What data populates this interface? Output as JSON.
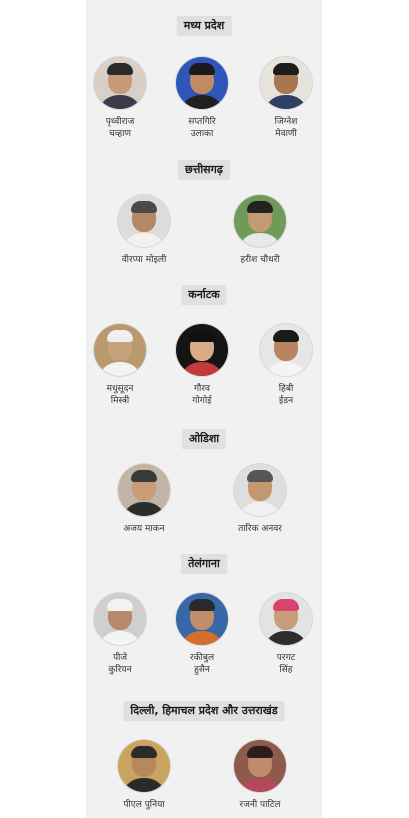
{
  "sections": [
    {
      "heading": "मध्य प्रदेश",
      "people": [
        {
          "line1": "पृथ्वीराज",
          "line2": "चव्हाण",
          "bg": "#d9cfc4",
          "skin": "#c59a78",
          "hair": "#2a2a2a",
          "cloth": "#3b3b4a"
        },
        {
          "line1": "सप्तगिरि",
          "line2": "उलाका",
          "bg": "#2f55b8",
          "skin": "#c08a63",
          "hair": "#1a1a1a",
          "cloth": "#202020"
        },
        {
          "line1": "जिग्नेश",
          "line2": "मेवाणी",
          "bg": "#e6e2dc",
          "skin": "#a97552",
          "hair": "#1d1d1d",
          "cloth": "#2d3f63"
        }
      ]
    },
    {
      "heading": "छत्तीसगढ़",
      "people": [
        {
          "line1": "वीरप्पा मोइली",
          "line2": "",
          "bg": "#dcdcdc",
          "skin": "#b58763",
          "hair": "#4a4a4a",
          "cloth": "#f1f1f1"
        },
        {
          "line1": "हरीश चौधरी",
          "line2": "",
          "bg": "#6f9a57",
          "skin": "#c39a72",
          "hair": "#222222",
          "cloth": "#e8e8e8"
        }
      ]
    },
    {
      "heading": "कर्नाटक",
      "people": [
        {
          "line1": "मधुसूदन",
          "line2": "मिस्त्री",
          "bg": "#b89a6e",
          "skin": "#c7a17c",
          "hair": "#efefef",
          "cloth": "#f3f3f3"
        },
        {
          "line1": "गौरव",
          "line2": "गोगोई",
          "bg": "#151515",
          "skin": "#d8ab85",
          "hair": "#111111",
          "cloth": "#c23a3a"
        },
        {
          "line1": "हिबी",
          "line2": "ईडन",
          "bg": "#e6e6e6",
          "skin": "#b98460",
          "hair": "#1a1a1a",
          "cloth": "#f4f4f4"
        }
      ]
    },
    {
      "heading": "ओडिशा",
      "people": [
        {
          "line1": "अजय माकन",
          "line2": "",
          "bg": "#c2b5a7",
          "skin": "#c79c78",
          "hair": "#3a3a3a",
          "cloth": "#2c2c2c"
        },
        {
          "line1": "तारिक अनवर",
          "line2": "",
          "bg": "#dedede",
          "skin": "#c4976f",
          "hair": "#555555",
          "cloth": "#f0f0f0"
        }
      ]
    },
    {
      "heading": "तेलंगाना",
      "people": [
        {
          "line1": "पीजे",
          "line2": "कुरियन",
          "bg": "#cfcfcf",
          "skin": "#b9896a",
          "hair": "#f2f2f2",
          "cloth": "#f4f4f4"
        },
        {
          "line1": "रकीबुल",
          "line2": "हुसैन",
          "bg": "#3867a8",
          "skin": "#c08f6a",
          "hair": "#2a2a2a",
          "cloth": "#d66e2b"
        },
        {
          "line1": "परगट",
          "line2": "सिंह",
          "bg": "#e3e3e3",
          "skin": "#c79d7a",
          "hair": "#d9446f",
          "cloth": "#2e2e2e"
        }
      ]
    },
    {
      "heading": "दिल्ली, हिमाचल प्रदेश और उत्तराखंड",
      "people": [
        {
          "line1": "पीएल पुनिया",
          "line2": "",
          "bg": "#c9a45f",
          "skin": "#b98662",
          "hair": "#2b2b2b",
          "cloth": "#2a2a2a"
        },
        {
          "line1": "रजनी पाटिल",
          "line2": "",
          "bg": "#8e5a4c",
          "skin": "#c08a6c",
          "hair": "#2a1d1a",
          "cloth": "#b5485a"
        }
      ]
    }
  ]
}
